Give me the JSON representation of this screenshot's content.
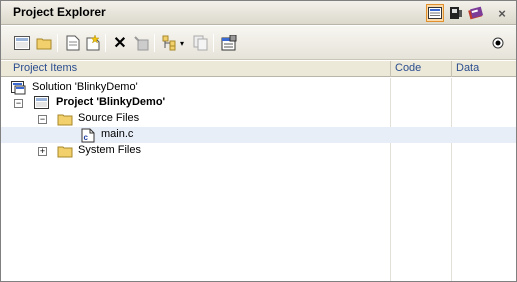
{
  "panel": {
    "title": "Project Explorer"
  },
  "title_icons": [
    "project-view-icon",
    "device-icon",
    "books-icon",
    "close-icon"
  ],
  "close_glyph": "×",
  "columns": {
    "items": "Project Items",
    "code": "Code",
    "data": "Data"
  },
  "tree": [
    {
      "label": "Solution 'BlinkyDemo'",
      "level": 0,
      "icon": "solution-icon",
      "bold": false,
      "toggle": null
    },
    {
      "label": "Project 'BlinkyDemo'",
      "level": 1,
      "icon": "project-icon",
      "bold": true,
      "toggle": "−"
    },
    {
      "label": "Source Files",
      "level": 2,
      "icon": "folder-icon",
      "bold": false,
      "toggle": "−"
    },
    {
      "label": "main.c",
      "level": 3,
      "icon": "c-file-icon",
      "bold": false,
      "toggle": null,
      "selected": true
    },
    {
      "label": "System Files",
      "level": 2,
      "icon": "folder-icon",
      "bold": false,
      "toggle": "+"
    }
  ]
}
